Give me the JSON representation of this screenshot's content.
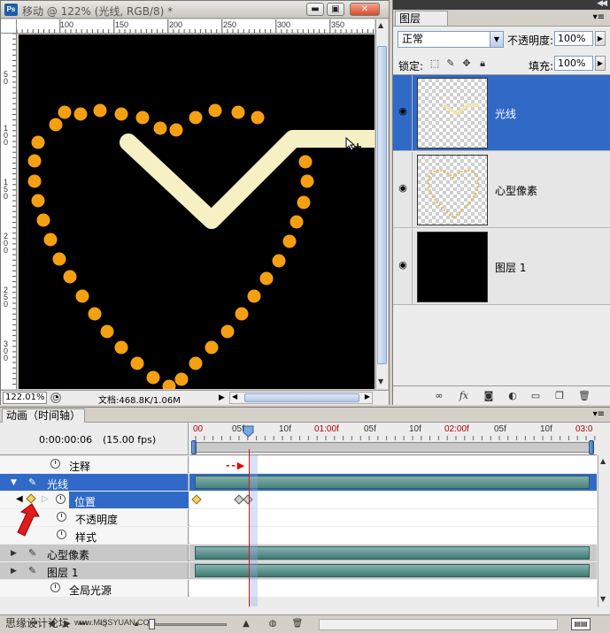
{
  "document": {
    "title": "移动 @ 122% (光线, RGB/8) *",
    "logo": "Ps",
    "window_buttons": {
      "minimize": "▬",
      "maximize": "▣",
      "close": "✕"
    },
    "ruler_top_labels": [
      "100",
      "150",
      "200",
      "250",
      "300",
      "350"
    ],
    "ruler_left_labels": [
      "5 0",
      "1 0 0",
      "1 5 0",
      "2 0 0",
      "2 5 0",
      "3 0 0",
      "3 5 0"
    ],
    "zoom_level": "122.01%",
    "doc_size": "文档:468.8K/1.06M"
  },
  "layers_panel": {
    "tab_label": "图层",
    "blend_mode": "正常",
    "opacity_label": "不透明度:",
    "opacity_value": "100%",
    "lock_label": "锁定:",
    "fill_label": "填充:",
    "fill_value": "100%",
    "layers": [
      {
        "name": "光线",
        "selected": true,
        "visible": true
      },
      {
        "name": "心型像素",
        "selected": false,
        "visible": true
      },
      {
        "name": "图层 1",
        "selected": false,
        "visible": true
      }
    ],
    "footer_icons": [
      "link-icon",
      "fx-icon",
      "mask-icon",
      "adjustment-icon",
      "group-icon",
      "new-layer-icon",
      "trash-icon"
    ]
  },
  "animation_panel": {
    "tab_label": "动画（时间轴）",
    "current_time": "0:00:00:06",
    "fps": "(15.00 fps)",
    "ruler_labels": [
      {
        "text": "00",
        "red": true
      },
      {
        "text": "05f",
        "red": false
      },
      {
        "text": "10f",
        "red": false
      },
      {
        "text": "01:00f",
        "red": true
      },
      {
        "text": "05f",
        "red": false
      },
      {
        "text": "10f",
        "red": false
      },
      {
        "text": "02:00f",
        "red": true
      },
      {
        "text": "05f",
        "red": false
      },
      {
        "text": "10f",
        "red": false
      },
      {
        "text": "03:0",
        "red": true
      }
    ],
    "tracks": {
      "comments": "注释",
      "layer_guangxian": "光线",
      "position": "位置",
      "opacity": "不透明度",
      "style": "样式",
      "layer_heart": "心型像素",
      "layer_1": "图层 1",
      "global_light": "全局光源"
    },
    "watermark": "思缘设计论坛",
    "watermark_url": "www.MISSYUAN.COM"
  },
  "colors": {
    "selection_blue": "#3169c6",
    "heart_dot_orange": "#f5a011",
    "light_line_cream": "#f7f0c4",
    "layer_bar_teal": "#4a837d",
    "playhead_red": "#dd1111"
  }
}
